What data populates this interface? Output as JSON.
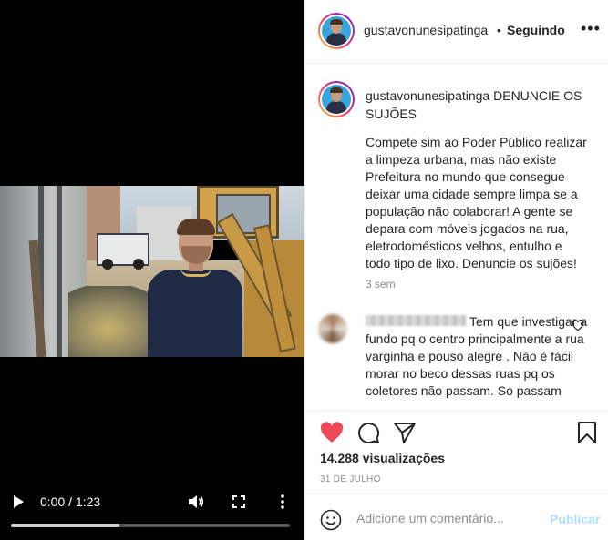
{
  "video": {
    "time": "0:00 / 1:23",
    "progress": 0.39
  },
  "header": {
    "username": "gustavonunesipatinga",
    "separator": "•",
    "follow_status": "Seguindo",
    "options": "•••"
  },
  "caption": {
    "username": "gustavonunesipatinga",
    "title": "DENUNCIE OS SUJÕES",
    "body": "Compete sim ao Poder Público realizar a limpeza urbana, mas não existe Prefeitura no mundo que consegue deixar uma cidade sempre limpa se a população não colaborar! A gente se depara com móveis jogados na rua, eletrodomésticos velhos, entulho e todo tipo de lixo. Denuncie os sujões!",
    "time_ago": "3 sem"
  },
  "comment": {
    "text": "Tem que investigar a fundo pq o centro principalmente a rua varginha e pouso alegre . Não é fácil morar no beco dessas ruas pq os coletores não passam. So passam"
  },
  "actions": {
    "views": "14.288 visualizações",
    "date": "31 DE JULHO"
  },
  "add_comment": {
    "placeholder": "Adicione um comentário...",
    "publish": "Publicar"
  },
  "colors": {
    "like_red": "#ed4956",
    "publish_disabled": "#b2dffc",
    "muted_text": "#8e8e8e"
  }
}
